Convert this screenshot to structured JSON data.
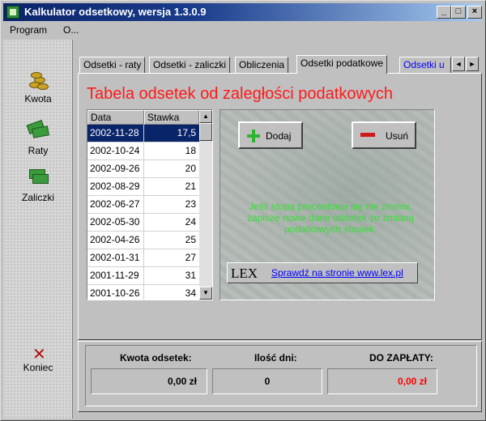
{
  "window": {
    "title": "Kalkulator odsetkowy, wersja 1.3.0.9",
    "minimize_glyph": "_",
    "maximize_glyph": "□",
    "close_glyph": "×"
  },
  "menu": [
    "Program",
    "O..."
  ],
  "sidebar": {
    "items": [
      {
        "label": "Kwota",
        "icon": "coins-icon"
      },
      {
        "label": "Raty",
        "icon": "money-icon"
      },
      {
        "label": "Zaliczki",
        "icon": "banknotes-icon"
      },
      {
        "label": "Koniec",
        "icon": "close-x-icon"
      }
    ],
    "koniec_glyph": "✕"
  },
  "tabs": {
    "items": [
      "Odsetki - raty",
      "Odsetki - zaliczki",
      "Obliczenia",
      "Odsetki podatkowe",
      "Odsetki u"
    ],
    "active_index": 3,
    "scroll_left": "◄",
    "scroll_right": "►"
  },
  "panel": {
    "title": "Tabela odsetek od zaległości podatkowych"
  },
  "rates_table": {
    "headers": [
      "Data",
      "Stawka"
    ],
    "rows": [
      {
        "date": "2002-11-28",
        "rate": "17,5"
      },
      {
        "date": "2002-10-24",
        "rate": "18"
      },
      {
        "date": "2002-09-26",
        "rate": "20"
      },
      {
        "date": "2002-08-29",
        "rate": "21"
      },
      {
        "date": "2002-06-27",
        "rate": "23"
      },
      {
        "date": "2002-05-30",
        "rate": "24"
      },
      {
        "date": "2002-04-26",
        "rate": "25"
      },
      {
        "date": "2002-01-31",
        "rate": "27"
      },
      {
        "date": "2001-11-29",
        "rate": "31"
      },
      {
        "date": "2001-10-26",
        "rate": "34"
      }
    ],
    "selected_index": 0,
    "scroll_up": "▲",
    "scroll_down": "▼"
  },
  "actions": {
    "add_label": "Dodaj",
    "remove_label": "Usuń"
  },
  "info": {
    "green_text": "Jeśli stopa procentowa się nie zmieni, zapiszę nowe dane odsetek ze zmianą podatkowych stawek.",
    "lex_mark": "LEX",
    "lex_link": "Sprawdź na stronie www.lex.pl"
  },
  "summary": {
    "interest_label": "Kwota odsetek:",
    "interest_value": "0,00 zł",
    "days_label": "Ilość dni:",
    "days_value": "0",
    "total_label": "DO ZAPŁATY:",
    "total_value": "0,00 zł",
    "total_color": "#ff0000"
  }
}
